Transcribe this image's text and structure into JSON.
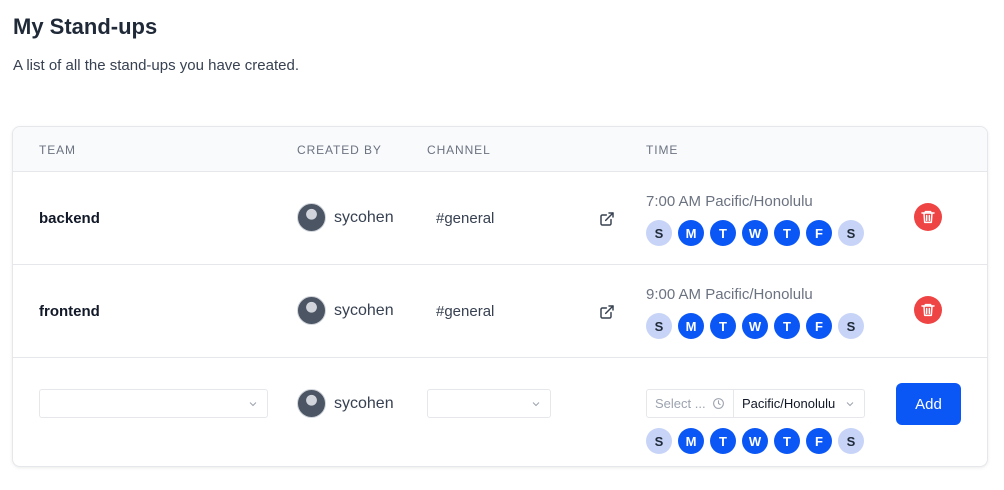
{
  "page": {
    "title": "My Stand-ups",
    "subtitle": "A list of all the stand-ups you have created."
  },
  "table": {
    "headers": {
      "team": "TEAM",
      "created_by": "CREATED BY",
      "channel": "CHANNEL",
      "time": "TIME"
    },
    "rows": [
      {
        "team": "backend",
        "creator": "sycohen",
        "channel": "#general",
        "time": "7:00 AM Pacific/Honolulu",
        "days": [
          {
            "label": "S",
            "active": false
          },
          {
            "label": "M",
            "active": true
          },
          {
            "label": "T",
            "active": true
          },
          {
            "label": "W",
            "active": true
          },
          {
            "label": "T",
            "active": true
          },
          {
            "label": "F",
            "active": true
          },
          {
            "label": "S",
            "active": false
          }
        ]
      },
      {
        "team": "frontend",
        "creator": "sycohen",
        "channel": "#general",
        "time": "9:00 AM Pacific/Honolulu",
        "days": [
          {
            "label": "S",
            "active": false
          },
          {
            "label": "M",
            "active": true
          },
          {
            "label": "T",
            "active": true
          },
          {
            "label": "W",
            "active": true
          },
          {
            "label": "T",
            "active": true
          },
          {
            "label": "F",
            "active": true
          },
          {
            "label": "S",
            "active": false
          }
        ]
      }
    ],
    "new_row": {
      "team_value": "",
      "creator": "sycohen",
      "channel_value": "",
      "time_placeholder": "Select ...",
      "timezone": "Pacific/Honolulu",
      "add_label": "Add",
      "days": [
        {
          "label": "S",
          "active": false
        },
        {
          "label": "M",
          "active": true
        },
        {
          "label": "T",
          "active": true
        },
        {
          "label": "W",
          "active": true
        },
        {
          "label": "T",
          "active": true
        },
        {
          "label": "F",
          "active": true
        },
        {
          "label": "S",
          "active": false
        }
      ]
    }
  },
  "colors": {
    "accent": "#0b57f5",
    "day_inactive": "#c7d4f8",
    "danger": "#ef4444"
  },
  "icons": {
    "external_link": "external-link-icon",
    "delete": "trash-icon",
    "clock": "clock-icon",
    "chevron": "chevron-down-icon"
  }
}
